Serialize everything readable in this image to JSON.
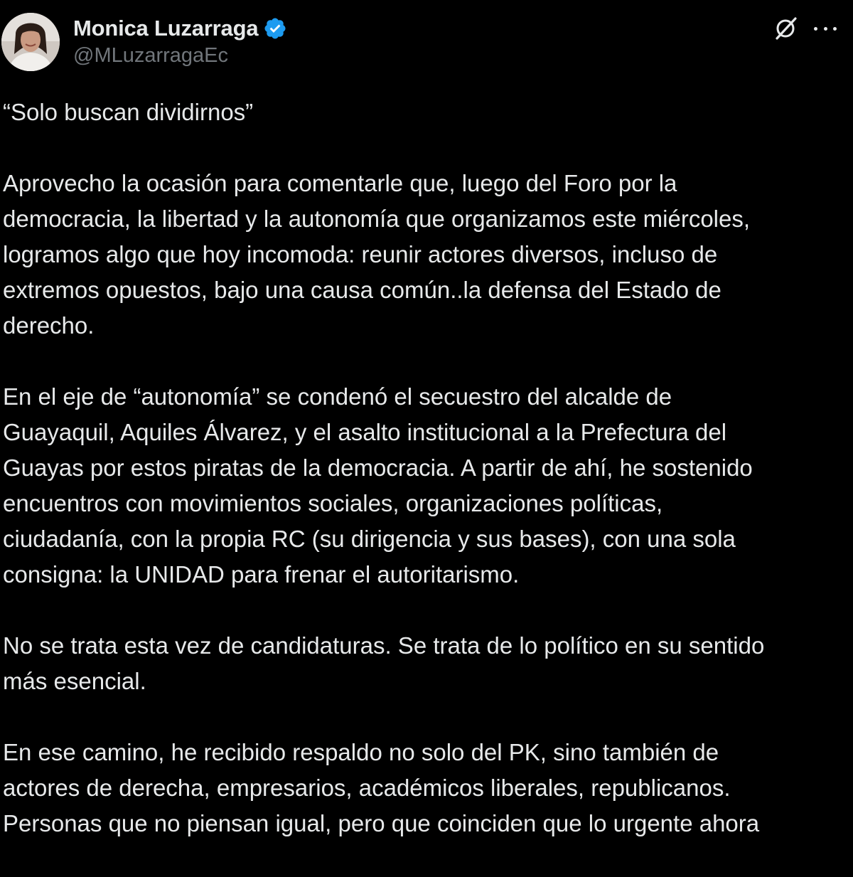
{
  "author": {
    "display_name": "Monica Luzarraga",
    "handle": "@MLuzarragaEc",
    "avatar_icon": "profile-photo",
    "verified_icon": "verified-badge-icon",
    "verified_color": "#1d9bf0"
  },
  "header_actions": {
    "grok_icon": "grok-icon",
    "more_icon": "more-options-icon"
  },
  "tweet": {
    "paragraphs": [
      "“Solo buscan dividirnos”",
      "Aprovecho la ocasión para comentarle que, luego del Foro por la\ndemocracia, la libertad y la autonomía que organizamos este miércoles,\nlogramos algo que hoy incomoda: reunir actores diversos, incluso de\nextremos opuestos, bajo una causa común..la defensa del Estado de\nderecho.",
      "En el eje de “autonomía” se condenó el secuestro del alcalde de\nGuayaquil, Aquiles Álvarez, y el asalto institucional a la Prefectura del\nGuayas por estos piratas de la democracia. A partir de ahí, he sostenido\nencuentros con movimientos sociales, organizaciones políticas,\nciudadanía, con la propia RC (su dirigencia y sus bases), con una sola\nconsigna: la UNIDAD para frenar el autoritarismo.",
      "No se trata esta vez de candidaturas. Se trata de lo político en su sentido\nmás esencial.",
      "En ese camino, he recibido respaldo no solo del PK, sino también de\nactores de derecha, empresarios, académicos liberales, republicanos.\nPersonas que no piensan igual, pero que coinciden que lo urgente ahora"
    ]
  },
  "colors": {
    "background": "#000000",
    "text": "#e7e9ea",
    "secondary_text": "#71767b",
    "accent": "#1d9bf0"
  }
}
